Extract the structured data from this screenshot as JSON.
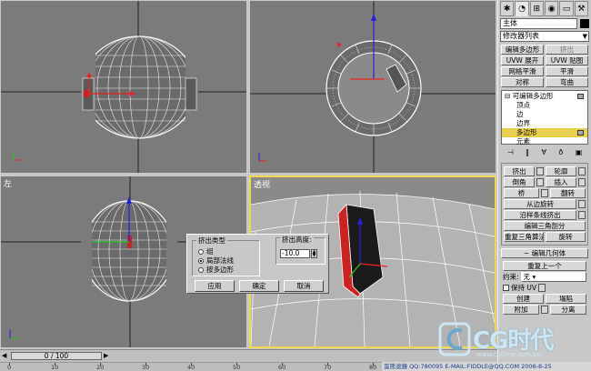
{
  "viewports": {
    "top": {
      "label": ""
    },
    "front": {
      "label": ""
    },
    "left": {
      "label": "左"
    },
    "perspective": {
      "label": "透视"
    }
  },
  "panel": {
    "tabs": [
      "create-icon",
      "modify-icon",
      "hierarchy-icon",
      "motion-icon",
      "display-icon",
      "utilities-icon"
    ],
    "object_name": "主体",
    "object_color": "#000000",
    "modifier_list": "修改器列表",
    "mod_buttons": [
      "编辑多边形",
      "挤出",
      "UVW 展开",
      "UVW 贴图",
      "网格平滑",
      "平滑",
      "对称",
      "弯曲"
    ],
    "stack": {
      "root": "可编辑多边形",
      "items": [
        "顶点",
        "边",
        "边界",
        "多边形",
        "元素"
      ],
      "selected_index": 3
    },
    "edit_poly": {
      "extrude": "挤出",
      "outline": "轮廓",
      "bevel": "倒角",
      "inset": "插入",
      "bridge": "桥",
      "flip": "翻转",
      "hinge": "从边旋转",
      "extrude_spline": "沿样条线挤出",
      "edit_tri": "编辑三角剖分",
      "retri": "重复三角算法",
      "turn": "旋转"
    },
    "edit_geom": {
      "title": "编辑几何体",
      "repeat": "重复上一个",
      "constraint_label": "约束:",
      "constraint_value": "无",
      "preserve_uv": "保持 UV",
      "create": "创建",
      "collapse": "塌陷",
      "attach": "附加",
      "detach": "分离"
    }
  },
  "timeline": {
    "frame": "0 / 100",
    "ticks": [
      "0",
      "10",
      "20",
      "30",
      "40",
      "50",
      "60",
      "70",
      "80",
      "90",
      "100"
    ]
  },
  "status_text": "蛮熊滤鏡 QQ:780095 E-MAIL:FIDDLE@QQ.COM 2006-8-25",
  "dialog": {
    "type_group": "挤出类型",
    "opt_group": "组",
    "opt_local": "局部法线",
    "opt_poly": "按多边形",
    "selected": "局部法线",
    "height_label": "挤出高度:",
    "height_value": "-10.0",
    "apply": "应用",
    "ok": "确定",
    "cancel": "取消"
  },
  "watermark": {
    "text": "CG时代",
    "sub": "www.cgtime.com.cn"
  },
  "colors": {
    "viewport_bg": "#7b7b7b",
    "active_border": "#f1d84a",
    "selection": "#e8cf4c",
    "selected_face": "#cc2222"
  }
}
